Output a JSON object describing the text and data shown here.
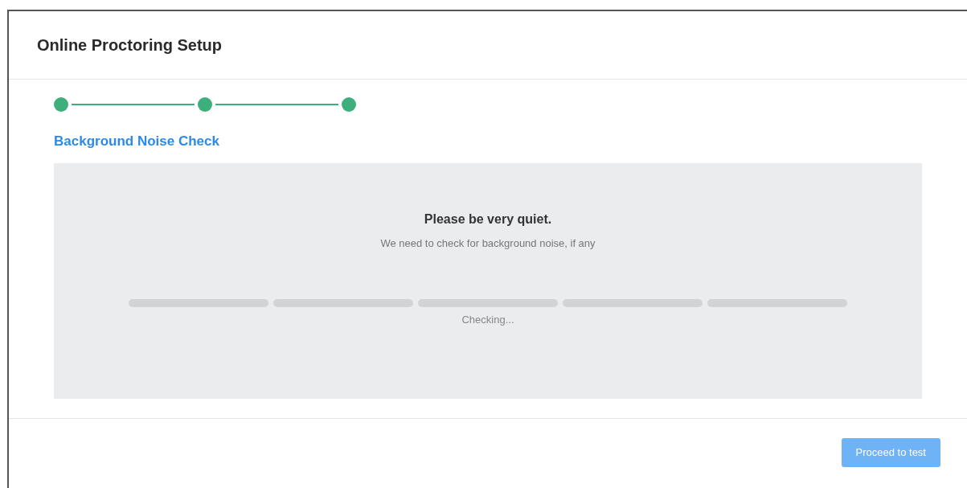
{
  "window": {
    "title": "Online Proctoring Setup"
  },
  "stepper": {
    "steps": [
      {
        "done": true
      },
      {
        "done": true
      },
      {
        "done": true
      }
    ]
  },
  "section": {
    "title": "Background Noise Check"
  },
  "check_panel": {
    "heading": "Please be very quiet.",
    "message": "We need to check for background noise, if any",
    "segments": [
      {
        "level": 0
      },
      {
        "level": 0
      },
      {
        "level": 0
      },
      {
        "level": 0
      },
      {
        "level": 0
      }
    ],
    "status": "Checking..."
  },
  "footer": {
    "button": {
      "label": "Proceed to test",
      "disabled": true
    }
  }
}
